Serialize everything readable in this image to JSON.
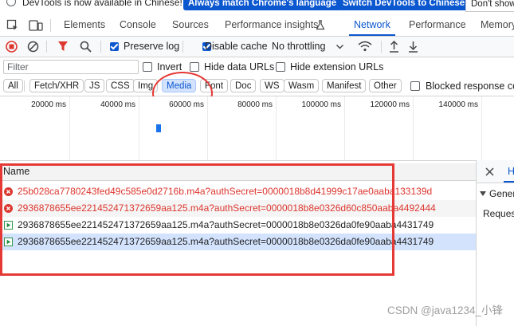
{
  "notice": {
    "text": "DevTools is now available in Chinese!",
    "btn_match": "Always match Chrome's language",
    "btn_switch": "Switch DevTools to Chinese",
    "btn_dont": "Don't show"
  },
  "tabs": [
    "Elements",
    "Console",
    "Sources",
    "Performance insights",
    "Network",
    "Performance",
    "Memory"
  ],
  "active_tab": "Network",
  "toolbar": {
    "preserve_log": "Preserve log",
    "disable_cache": "Disable cache",
    "throttling": "No throttling"
  },
  "filter": {
    "placeholder": "Filter",
    "invert": "Invert",
    "hide_data_urls": "Hide data URLs",
    "hide_extension_urls": "Hide extension URLs"
  },
  "type_chips": [
    "All",
    "Fetch/XHR",
    "JS",
    "CSS",
    "Img",
    "Media",
    "Font",
    "Doc",
    "WS",
    "Wasm",
    "Manifest",
    "Other"
  ],
  "selected_chip": "Media",
  "blocked_response": "Blocked response coo",
  "timeline_ticks": [
    "20000 ms",
    "40000 ms",
    "60000 ms",
    "80000 ms",
    "100000 ms",
    "120000 ms",
    "140000 ms"
  ],
  "name_header": "Name",
  "requests": [
    {
      "name": "25b028ca7780243fed49c585e0d2716b.m4a?authSecret=0000018b8d41999c17ae0aaba133139d",
      "status": "error"
    },
    {
      "name": "2936878655ee221452471372659aa125.m4a?authSecret=0000018b8e0326d60c850aaba4492444",
      "status": "error"
    },
    {
      "name": "2936878655ee221452471372659aa125.m4a?authSecret=0000018b8e0326da0fe90aaba4431749",
      "status": "ok"
    },
    {
      "name": "2936878655ee221452471372659aa125.m4a?authSecret=0000018b8e0326da0fe90aaba4431749",
      "status": "ok"
    }
  ],
  "right_panel": {
    "tab_initial": "H",
    "general": "Genera",
    "request": "Request"
  },
  "watermark": "CSDN @java1234_小锋",
  "colors": {
    "accent": "#0b57d0",
    "error": "#dc362e",
    "highlight": "#e53935",
    "selected_row": "#d3e3fd"
  }
}
